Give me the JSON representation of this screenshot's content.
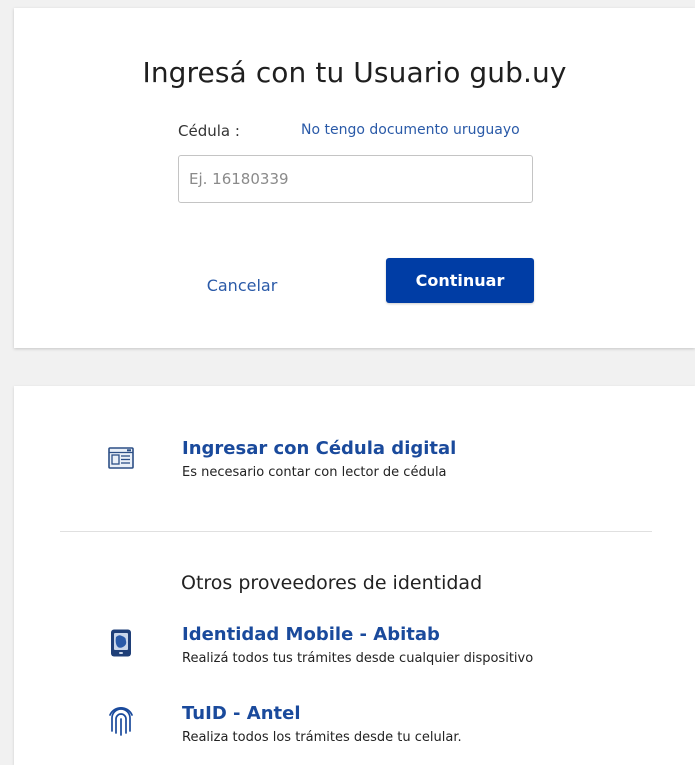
{
  "login": {
    "title": "Ingresá con tu Usuario gub.uy",
    "cedula_label": "Cédula :",
    "no_document_link": "No tengo documento uruguayo",
    "cedula_input": {
      "value": "",
      "placeholder": "Ej. 16180339"
    },
    "cancel_label": "Cancelar",
    "continue_label": "Continuar"
  },
  "digital_id": {
    "icon": "id-card-icon",
    "title": "Ingresar con Cédula digital",
    "description": "Es necesario contar con lector de cédula"
  },
  "other_providers": {
    "heading": "Otros proveedores de identidad",
    "items": [
      {
        "icon": "mobile-phone-icon",
        "title": "Identidad Mobile - Abitab",
        "description": "Realizá todos tus trámites desde cualquier dispositivo"
      },
      {
        "icon": "fingerprint-icon",
        "title": "TuID - Antel",
        "description": "Realiza todos los trámites desde tu celular."
      }
    ]
  },
  "colors": {
    "primary_button": "#003da5",
    "link": "#2a5aa8",
    "provider_title": "#1a4a9c",
    "page_background": "#f1f1f1"
  }
}
